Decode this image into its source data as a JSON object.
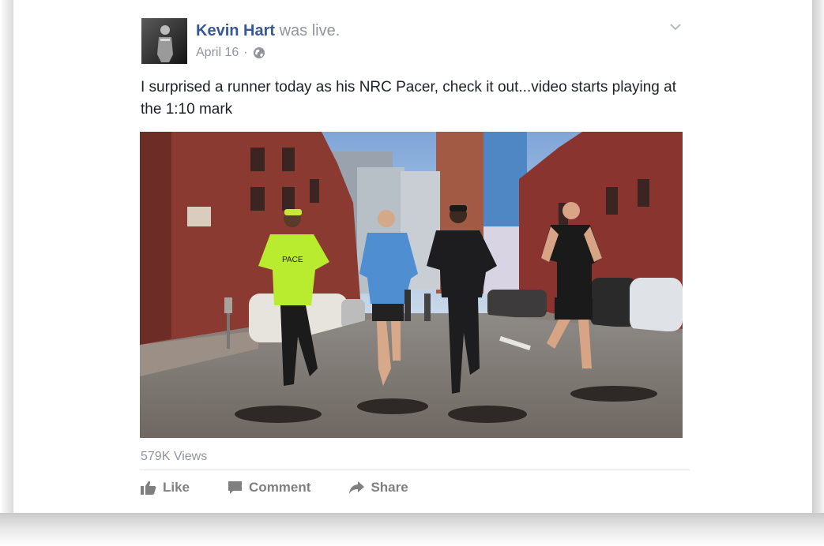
{
  "post": {
    "author": "Kevin Hart",
    "status": "was live.",
    "date": "April 16",
    "separator": "·",
    "privacy_icon": "globe-icon",
    "menu_icon": "chevron-down-icon",
    "text": "I surprised a runner today as his NRC Pacer, check it out...video starts playing at the 1:10 mark",
    "vest_text": "PACE",
    "views": "579K Views"
  },
  "actions": {
    "like": "Like",
    "comment": "Comment",
    "share": "Share"
  },
  "colors": {
    "author_link": "#365899",
    "meta_text": "#90949c",
    "body_text": "#1d2129",
    "action_text": "#7f7f7f"
  }
}
